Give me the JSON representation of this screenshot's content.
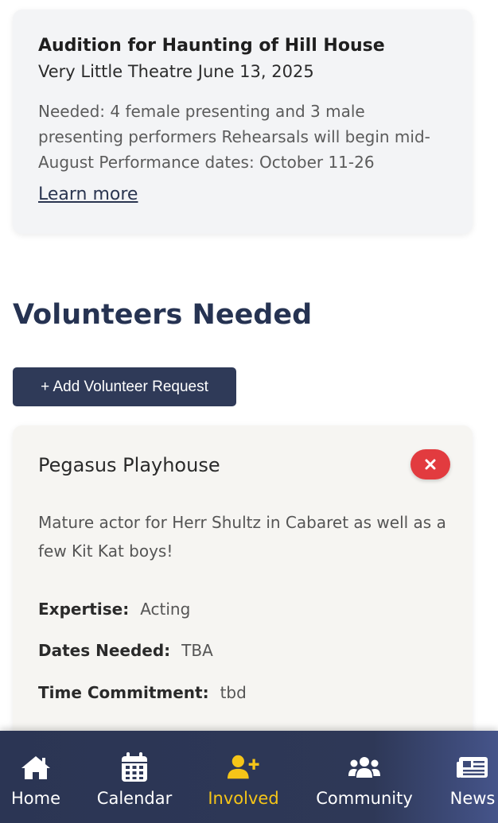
{
  "audition": {
    "title": "Audition for Haunting of Hill House",
    "venue_date": "Very Little Theatre June 13, 2025",
    "description": "Needed: 4 female presenting and 3 male presenting performers Rehearsals will begin mid-August Performance dates: October 11-26",
    "link_label": "Learn more"
  },
  "volunteers": {
    "heading": "Volunteers Needed",
    "add_button_label": "+ Add Volunteer Request",
    "requests": [
      {
        "organization": "Pegasus Playhouse",
        "description": "Mature actor for Herr Shultz in Cabaret as well as a few Kit Kat boys!",
        "expertise_label": "Expertise:",
        "expertise": "Acting",
        "dates_label": "Dates Needed:",
        "dates": "TBA",
        "time_label": "Time Commitment:",
        "time": "tbd"
      }
    ]
  },
  "nav": {
    "items": [
      {
        "label": "Home",
        "icon": "home-icon"
      },
      {
        "label": "Calendar",
        "icon": "calendar-icon"
      },
      {
        "label": "Involved",
        "icon": "user-plus-icon",
        "active": true
      },
      {
        "label": "Community",
        "icon": "users-icon"
      },
      {
        "label": "News",
        "icon": "newspaper-icon"
      }
    ],
    "active_color": "#f5c518",
    "background": "#2b3554"
  },
  "colors": {
    "heading": "#263352",
    "button": "#2f3a58",
    "delete": "#e23b3f"
  }
}
